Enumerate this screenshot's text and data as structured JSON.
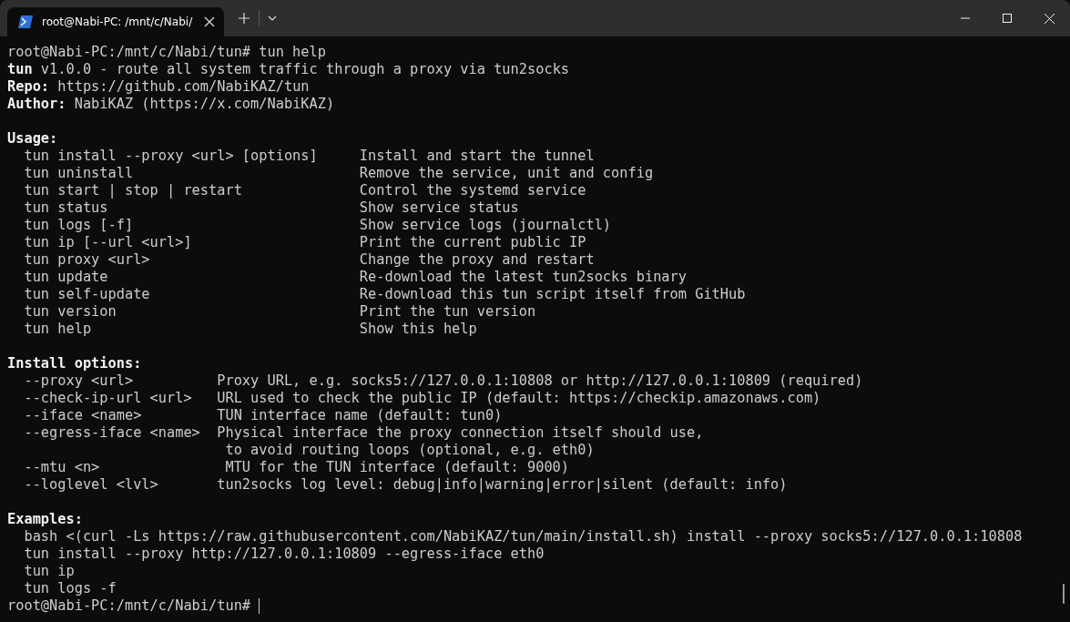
{
  "tabs": [
    {
      "title": "root@Nabi-PC: /mnt/c/Nabi/",
      "selected": true
    }
  ],
  "terminal": {
    "lines": [
      {
        "kind": "prompt",
        "text": "root@Nabi-PC:/mnt/c/Nabi/tun# tun help"
      },
      {
        "kind": "text",
        "text": "**tun** v1.0.0 - route all system traffic through a proxy via tun2socks"
      },
      {
        "kind": "text",
        "text": "**Repo:** https://github.com/NabiKAZ/tun"
      },
      {
        "kind": "text",
        "text": "**Author:** NabiKAZ (https://x.com/NabiKAZ)"
      },
      {
        "kind": "blank"
      },
      {
        "kind": "heading",
        "text": "Usage:"
      },
      {
        "kind": "text",
        "text": "  tun install --proxy <url> [options]     Install and start the tunnel"
      },
      {
        "kind": "text",
        "text": "  tun uninstall                           Remove the service, unit and config"
      },
      {
        "kind": "text",
        "text": "  tun start | stop | restart              Control the systemd service"
      },
      {
        "kind": "text",
        "text": "  tun status                              Show service status"
      },
      {
        "kind": "text",
        "text": "  tun logs [-f]                           Show service logs (journalctl)"
      },
      {
        "kind": "text",
        "text": "  tun ip [--url <url>]                    Print the current public IP"
      },
      {
        "kind": "text",
        "text": "  tun proxy <url>                         Change the proxy and restart"
      },
      {
        "kind": "text",
        "text": "  tun update                              Re-download the latest tun2socks binary"
      },
      {
        "kind": "text",
        "text": "  tun self-update                         Re-download this tun script itself from GitHub"
      },
      {
        "kind": "text",
        "text": "  tun version                             Print the tun version"
      },
      {
        "kind": "text",
        "text": "  tun help                                Show this help"
      },
      {
        "kind": "blank"
      },
      {
        "kind": "heading",
        "text": "Install options:"
      },
      {
        "kind": "text",
        "text": "  --proxy <url>          Proxy URL, e.g. socks5://127.0.0.1:10808 or http://127.0.0.1:10809 (required)"
      },
      {
        "kind": "text",
        "text": "  --check-ip-url <url>   URL used to check the public IP (default: https://checkip.amazonaws.com)"
      },
      {
        "kind": "text",
        "text": "  --iface <name>         TUN interface name (default: tun0)"
      },
      {
        "kind": "text",
        "text": "  --egress-iface <name>  Physical interface the proxy connection itself should use,"
      },
      {
        "kind": "text",
        "text": "                          to avoid routing loops (optional, e.g. eth0)"
      },
      {
        "kind": "text",
        "text": "  --mtu <n>               MTU for the TUN interface (default: 9000)"
      },
      {
        "kind": "text",
        "text": "  --loglevel <lvl>       tun2socks log level: debug|info|warning|error|silent (default: info)"
      },
      {
        "kind": "blank"
      },
      {
        "kind": "heading",
        "text": "Examples:"
      },
      {
        "kind": "text",
        "text": "  bash <(curl -Ls https://raw.githubusercontent.com/NabiKAZ/tun/main/install.sh) install --proxy socks5://127.0.0.1:10808"
      },
      {
        "kind": "text",
        "text": "  tun install --proxy http://127.0.0.1:10809 --egress-iface eth0"
      },
      {
        "kind": "text",
        "text": "  tun ip"
      },
      {
        "kind": "text",
        "text": "  tun logs -f"
      },
      {
        "kind": "cursor",
        "text": "root@Nabi-PC:/mnt/c/Nabi/tun# "
      }
    ]
  }
}
